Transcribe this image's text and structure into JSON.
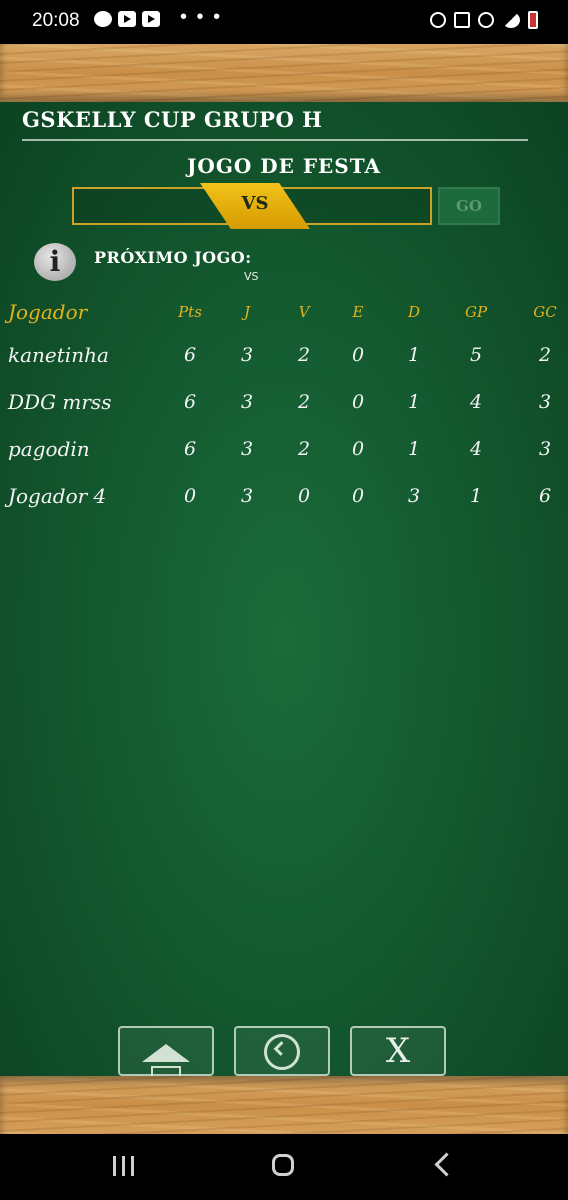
{
  "status_bar": {
    "time": "20:08",
    "left_icons": [
      "whatsapp-icon",
      "youtube-icon",
      "youtube-icon"
    ],
    "overflow": "• • •",
    "right_icons": [
      "alarm-icon",
      "mute-icon",
      "wifi-icon",
      "signal-icon",
      "battery-icon"
    ]
  },
  "header": {
    "title": "GSKELLY CUP GRUPO H"
  },
  "match": {
    "heading": "JOGO DE FESTA",
    "vs_label": "VS",
    "go_label": "GO"
  },
  "next_match": {
    "label": "PRÓXIMO JOGO:",
    "vs": "VS"
  },
  "table": {
    "columns": [
      "Jogador",
      "Pts",
      "J",
      "V",
      "E",
      "D",
      "GP",
      "GC"
    ],
    "rows": [
      {
        "player": "kanetinha",
        "pts": "6",
        "j": "3",
        "v": "2",
        "e": "0",
        "d": "1",
        "gp": "5",
        "gc": "2"
      },
      {
        "player": "DDG mrss",
        "pts": "6",
        "j": "3",
        "v": "2",
        "e": "0",
        "d": "1",
        "gp": "4",
        "gc": "3"
      },
      {
        "player": "pagodin",
        "pts": "6",
        "j": "3",
        "v": "2",
        "e": "0",
        "d": "1",
        "gp": "4",
        "gc": "3"
      },
      {
        "player": "Jogador 4",
        "pts": "0",
        "j": "3",
        "v": "0",
        "e": "0",
        "d": "3",
        "gp": "1",
        "gc": "6"
      }
    ]
  },
  "bottom_buttons": {
    "home_icon": "home-icon",
    "back_icon": "back-icon",
    "close_label": "X"
  },
  "colors": {
    "board": "#145a30",
    "accent_gold": "#e3b21f",
    "chalk": "#f3f3f3",
    "wood": "#c98f49"
  }
}
